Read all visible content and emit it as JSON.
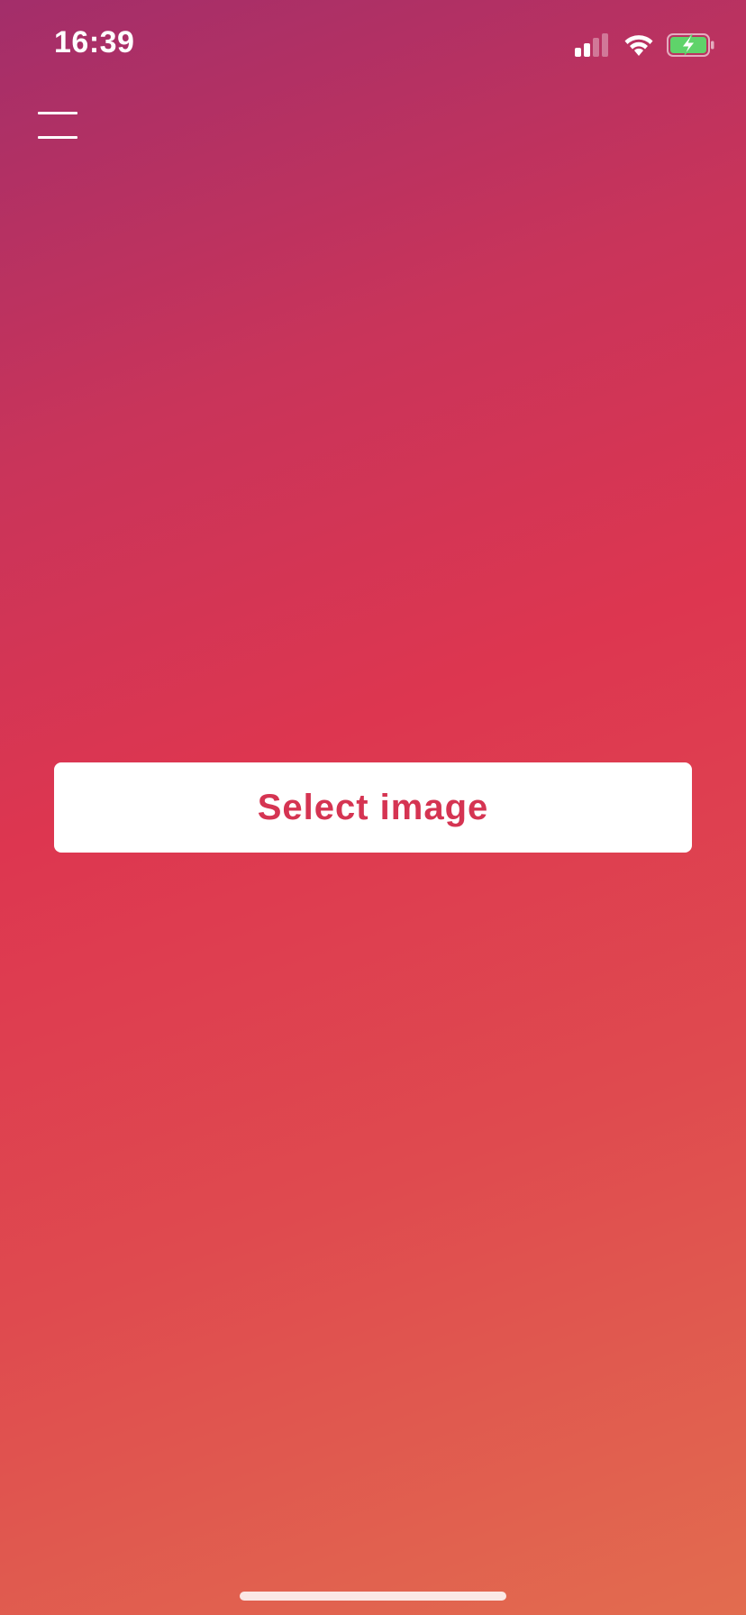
{
  "status_bar": {
    "time": "16:39",
    "icons": [
      "signal-icon",
      "wifi-icon",
      "battery-charging-icon"
    ],
    "battery_color": "#5fd36a"
  },
  "header": {
    "menu_icon": "hamburger-menu-icon"
  },
  "main": {
    "select_image_label": "Select image"
  },
  "colors": {
    "accent": "#d53452",
    "gradient_start": "#a32e6a",
    "gradient_mid": "#dd3650",
    "gradient_end": "#e26c4f"
  }
}
